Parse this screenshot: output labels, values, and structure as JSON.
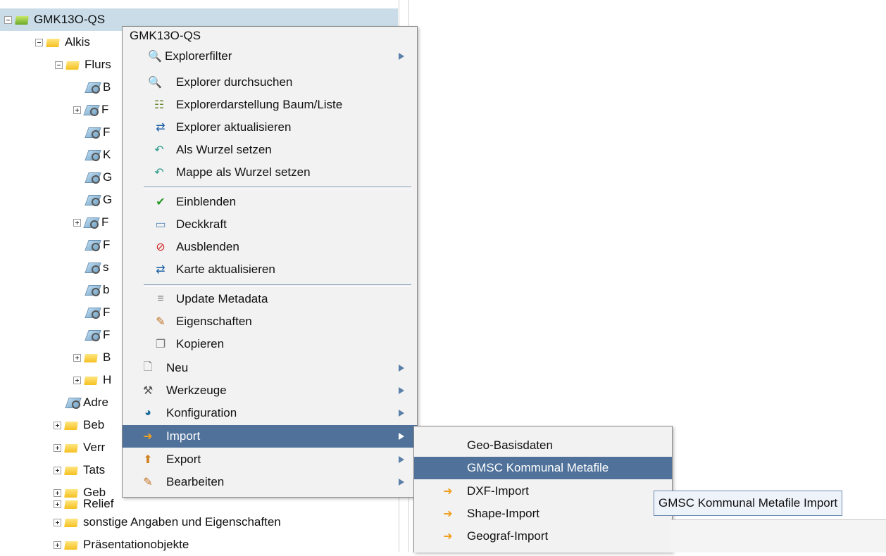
{
  "tree": {
    "root": "GMK13O-QS",
    "alkis": "Alkis",
    "flurs": "Flurs",
    "sub_items": [
      "B",
      "F",
      "F",
      "K",
      "G",
      "G",
      "F",
      "F",
      "s",
      "b",
      "F",
      "F",
      "B",
      "H"
    ],
    "adre": "Adre",
    "groups": [
      "Beb",
      "Verr",
      "Tats",
      "Geb",
      "Relief",
      "sonstige Angaben und Eigenschaften",
      "Präsentationobjekte"
    ]
  },
  "context_menu": {
    "title": "GMK13O-QS",
    "items": [
      {
        "label": "Explorerfilter",
        "icon": "explorer-filter-icon"
      },
      {
        "label": "Explorer durchsuchen",
        "icon": "explorer-search-icon"
      },
      {
        "label": "Explorerdarstellung Baum/Liste",
        "icon": "tree-list-icon"
      },
      {
        "label": "Explorer aktualisieren",
        "icon": "refresh-icon"
      },
      {
        "label": "Als Wurzel setzen",
        "icon": "set-root-icon"
      },
      {
        "label": "Mappe als Wurzel setzen",
        "icon": "folder-root-icon"
      },
      {
        "label": "Einblenden",
        "icon": "show-layer-icon"
      },
      {
        "label": "Deckkraft",
        "icon": "opacity-icon"
      },
      {
        "label": "Ausblenden",
        "icon": "hide-layer-icon"
      },
      {
        "label": "Karte aktualisieren",
        "icon": "refresh-icon"
      },
      {
        "label": "Update Metadata",
        "icon": "database-icon"
      },
      {
        "label": "Eigenschaften",
        "icon": "properties-icon"
      },
      {
        "label": "Kopieren",
        "icon": "copy-icon"
      },
      {
        "label": "Neu",
        "icon": "new-document-icon"
      },
      {
        "label": "Werkzeuge",
        "icon": "tools-icon"
      },
      {
        "label": "Konfiguration",
        "icon": "configuration-icon"
      },
      {
        "label": "Import",
        "icon": "import-icon"
      },
      {
        "label": "Export",
        "icon": "export-icon"
      },
      {
        "label": "Bearbeiten",
        "icon": "edit-icon"
      }
    ]
  },
  "import_submenu": {
    "items": [
      {
        "label": "Geo-Basisdaten"
      },
      {
        "label": "GMSC Kommunal Metafile"
      },
      {
        "label": "DXF-Import",
        "icon": "import-icon"
      },
      {
        "label": "Shape-Import",
        "icon": "import-icon"
      },
      {
        "label": "Geograf-Import",
        "icon": "import-icon"
      }
    ]
  },
  "tooltip": "GMSC Kommunal Metafile Import",
  "colors": {
    "highlight": "#50729a",
    "selection": "#c9dce8",
    "menu_bg": "#f2f2f2"
  }
}
